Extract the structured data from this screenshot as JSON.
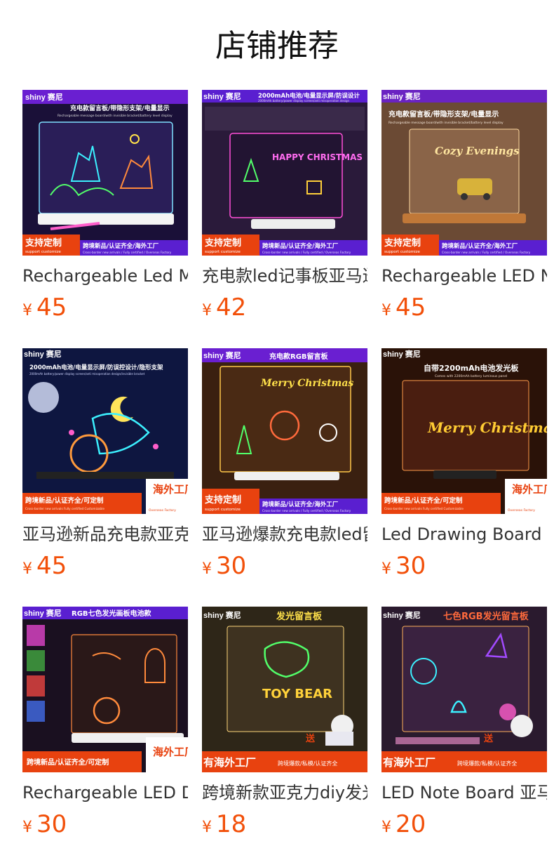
{
  "page": {
    "title": "店铺推荐"
  },
  "colors": {
    "price": "#f2500a",
    "banner": "#e8420f",
    "brand_bar": "#6a1fd1"
  },
  "products": [
    {
      "name": "Rechargeable Led Message Board",
      "currency": "¥",
      "price": "45",
      "image": {
        "brand": "shiny 赛尼",
        "headline": "充电款留言板/带隐形支架/电量显示",
        "sub": "Rechargeable message board/with invisible bracket/battery level display",
        "art": "LED deer drawing board",
        "badge": "支持定制",
        "badge_sub": "support customize",
        "footer": "跨境新品/认证齐全/海外工厂",
        "footer_sub": "Cross-border new arrivals / Fully certified / Overseas Factory"
      }
    },
    {
      "name": "充电款led记事板亚马逊",
      "currency": "¥",
      "price": "42",
      "image": {
        "brand": "shiny 赛尼",
        "headline": "2000mAh电池/电量显示屏/防误设计",
        "sub": "2000mAh battery/power display screen/anti misoperation design",
        "art": "HAPPY CHRISTMAS",
        "badge": "支持定制",
        "badge_sub": "support customize",
        "footer": "跨境新品/认证齐全/海外工厂",
        "footer_sub": "Cross-border new arrivals / Fully certified / Overseas Factory"
      }
    },
    {
      "name": "Rechargeable LED Note Board",
      "currency": "¥",
      "price": "45",
      "image": {
        "brand": "shiny 赛尼",
        "headline": "充电款留言板/带隐形支架/电量显示",
        "sub": "Rechargeable message board/with invisible bracket/battery level display",
        "art": "Cozy Evenings",
        "badge": "支持定制",
        "badge_sub": "support customize",
        "footer": "跨境新品/认证齐全/海外工厂",
        "footer_sub": "Cross-border new arrivals / Fully certified / Overseas Factory"
      }
    },
    {
      "name": "亚马逊新品充电款亚克力",
      "currency": "¥",
      "price": "45",
      "image": {
        "brand": "shiny 赛尼",
        "headline": "2000mAh电池/电量显示屏/防误控设计/隐形支架",
        "sub": "2000mAh battery/power display screen/anti misoperation design/invisible bracket",
        "art": "LED mermaid drawing",
        "badge": "",
        "badge_sub": "",
        "footer": "跨境新品/认证齐全/可定制",
        "footer_sub": "Cross-border new arrivals Fully certified Customizable",
        "side_badge": "海外工厂",
        "side_badge_sub": "Overseas Factory"
      }
    },
    {
      "name": "亚马逊爆款充电款led留言板",
      "currency": "¥",
      "price": "30",
      "image": {
        "brand": "shiny 赛尼",
        "headline": "充电款RGB留言板",
        "sub": "",
        "art": "Merry Christmas",
        "badge": "支持定制",
        "badge_sub": "support customize",
        "footer": "跨境新品/认证齐全/海外工厂",
        "footer_sub": "Cross-border new arrivals / Fully certified / Overseas Factory"
      }
    },
    {
      "name": "Led Drawing Board",
      "currency": "¥",
      "price": "30",
      "image": {
        "brand": "shiny 赛尼",
        "headline": "自带2200mAh电池发光板",
        "sub": "Comes with 2200mAh battery luminous panel",
        "art": "Merry Christmas",
        "badge": "",
        "badge_sub": "",
        "footer": "跨境新品/认证齐全/可定制",
        "footer_sub": "Cross-border new arrivals Fully certified Customizable",
        "side_badge": "海外工厂",
        "side_badge_sub": "Overseas Factory"
      }
    },
    {
      "name": "Rechargeable LED Drawing Board",
      "currency": "¥",
      "price": "30",
      "image": {
        "brand": "shiny 赛尼",
        "headline": "RGB七色发光画板电池款",
        "sub": "",
        "art": "Halloween pumpkin bats",
        "badge": "",
        "badge_sub": "",
        "footer": "跨境新品/认证齐全/可定制",
        "footer_sub": "",
        "side_badge": "海外工厂",
        "side_badge_sub": ""
      }
    },
    {
      "name": "跨境新款亚克力diy发光板",
      "currency": "¥",
      "price": "18",
      "image": {
        "brand": "shiny 赛尼",
        "headline": "发光留言板",
        "sub": "",
        "art": "TOY BEAR",
        "badge": "",
        "badge_sub": "",
        "footer": "有海外工厂",
        "footer_sub": "跨境爆款/私模/认证齐全",
        "corner": "送"
      }
    },
    {
      "name": "LED Note Board 亚马逊",
      "currency": "¥",
      "price": "20",
      "image": {
        "brand": "shiny 赛尼",
        "headline": "七色RGB发光留言板",
        "sub": "",
        "art": "Halloween witch hat",
        "badge": "",
        "badge_sub": "",
        "footer": "有海外工厂",
        "footer_sub": "跨境爆款/私模/认证齐全",
        "corner": "送"
      }
    }
  ]
}
